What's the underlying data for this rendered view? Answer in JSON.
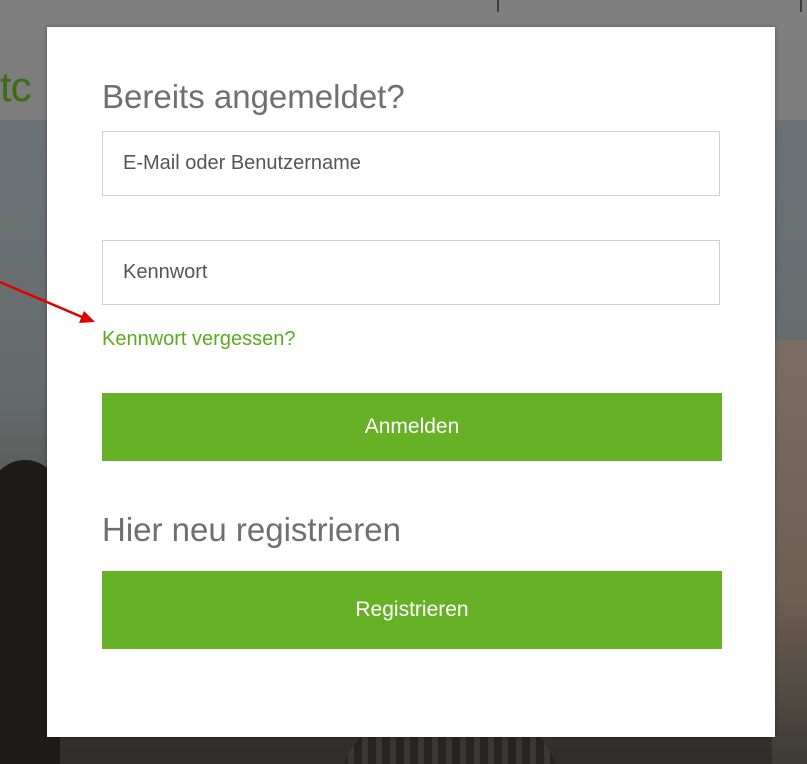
{
  "background": {
    "logo_fragment": "tc"
  },
  "login": {
    "title": "Bereits angemeldet?",
    "email_placeholder": "E-Mail oder Benutzername",
    "email_value": "",
    "password_placeholder": "Kennwort",
    "password_value": "",
    "forgot_password_label": "Kennwort vergessen?",
    "submit_label": "Anmelden"
  },
  "register": {
    "title": "Hier neu registrieren",
    "button_label": "Registrieren"
  },
  "colors": {
    "accent_green": "#67b126",
    "link_green": "#5aac1e",
    "heading_gray": "#6f6f6f",
    "annotation_red": "#e00000"
  },
  "icons": {
    "annotation": "red-arrow-icon"
  }
}
